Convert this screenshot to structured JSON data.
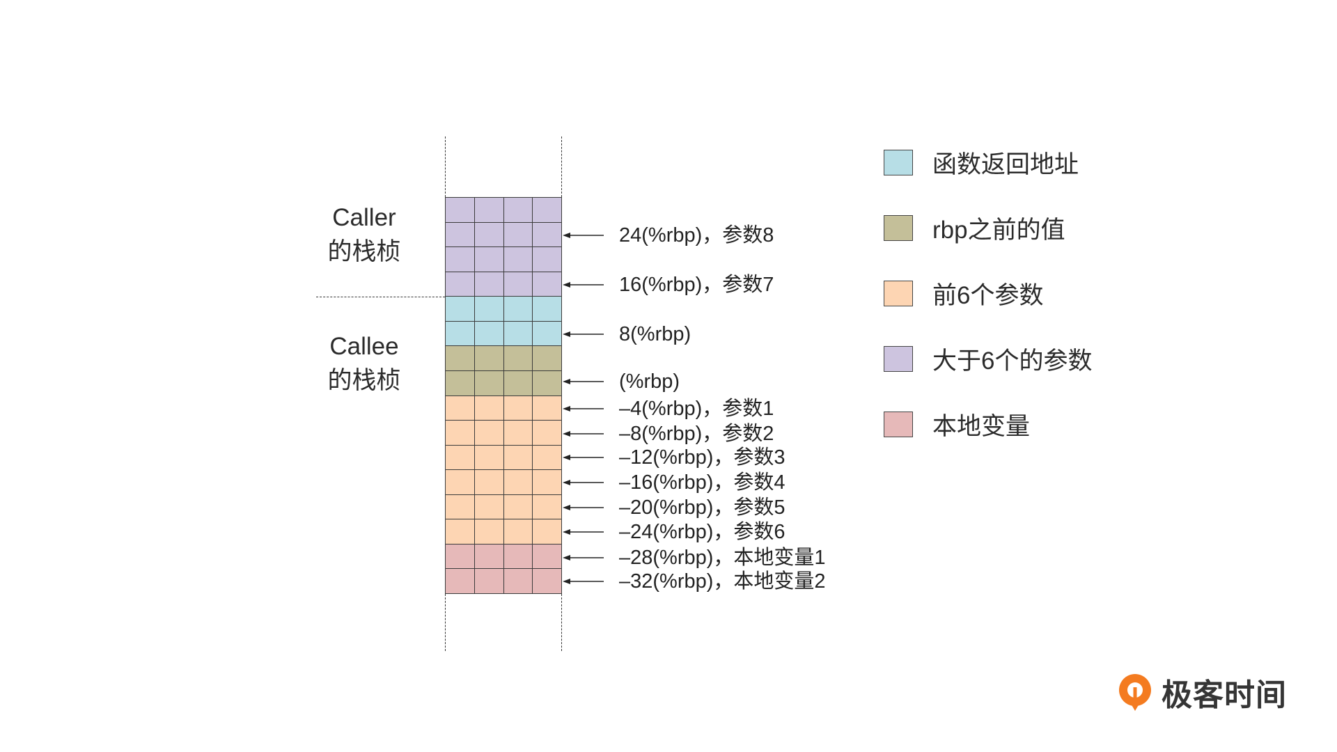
{
  "caller": {
    "name": "Caller",
    "frame": "的栈桢"
  },
  "callee": {
    "name": "Callee",
    "frame": "的栈桢"
  },
  "offset_labels": [
    "24(%rbp)，参数8",
    "16(%rbp)，参数7",
    "8(%rbp)",
    "(%rbp)",
    "–4(%rbp)，参数1",
    "–8(%rbp)，参数2",
    "–12(%rbp)，参数3",
    "–16(%rbp)，参数4",
    "–20(%rbp)，参数5",
    "–24(%rbp)，参数6",
    "–28(%rbp)，本地变量1",
    "–32(%rbp)，本地变量2"
  ],
  "legend": {
    "return_address": {
      "label": "函数返回地址",
      "color": "#b7dee6"
    },
    "saved_rbp": {
      "label": "rbp之前的值",
      "color": "#c4bf99"
    },
    "first_six_params": {
      "label": "前6个参数",
      "color": "#fdd5b3"
    },
    "extra_params": {
      "label": "大于6个的参数",
      "color": "#cdc4df"
    },
    "locals": {
      "label": "本地变量",
      "color": "#e6b9b9"
    }
  },
  "logo": {
    "text": "极客时间",
    "color": "#f47b20"
  }
}
